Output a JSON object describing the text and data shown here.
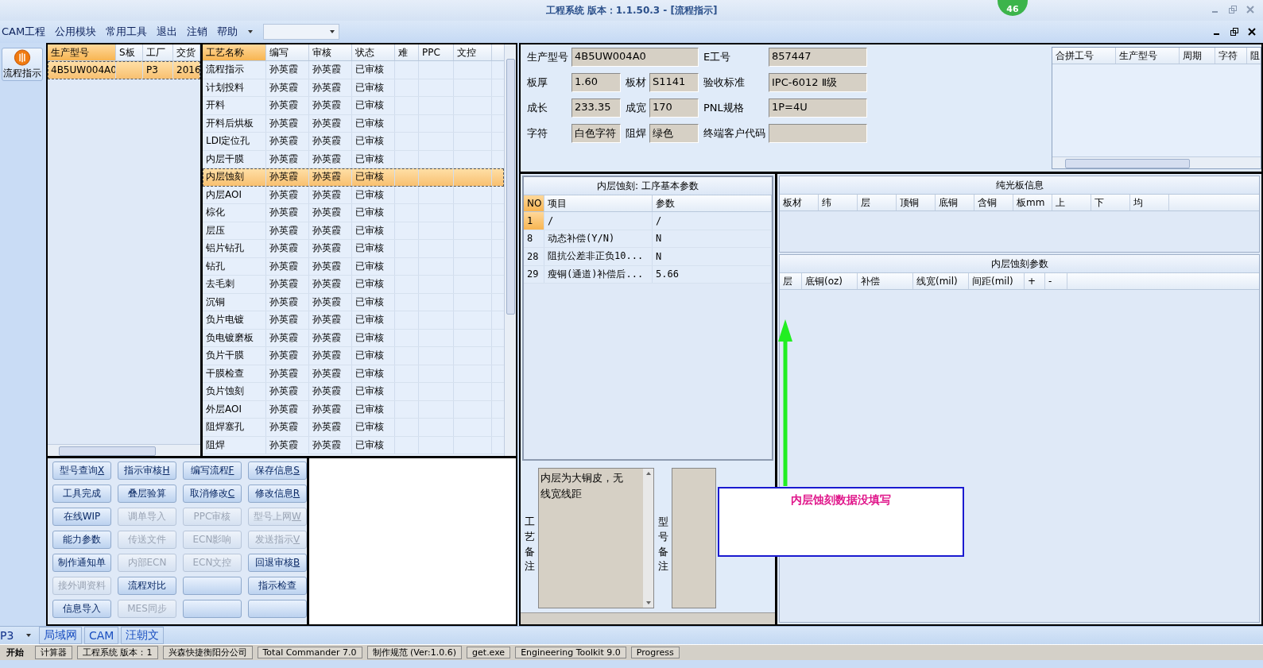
{
  "window": {
    "title": "工程系统  版本：1.1.50.3 - [流程指示]",
    "badge": "46"
  },
  "menu": [
    "CAM工程",
    "公用模块",
    "常用工具",
    "退出",
    "注销",
    "帮助"
  ],
  "sidebar": {
    "label": "流程指示"
  },
  "models": {
    "columns": [
      "生产型号",
      "S板",
      "工厂",
      "交货"
    ],
    "rows": [
      {
        "cells": [
          "4B5UW004A0",
          "",
          "P3",
          "2016"
        ],
        "selected": true
      }
    ]
  },
  "process": {
    "columns": [
      "工艺名称",
      "编写",
      "审核",
      "状态",
      "难",
      "PPC",
      "文控"
    ],
    "rows": [
      {
        "cells": [
          "流程指示",
          "孙英霞",
          "孙英霞",
          "已审核"
        ],
        "selected": false
      },
      {
        "cells": [
          "计划投料",
          "孙英霞",
          "孙英霞",
          "已审核"
        ],
        "selected": false
      },
      {
        "cells": [
          "开料",
          "孙英霞",
          "孙英霞",
          "已审核"
        ],
        "selected": false
      },
      {
        "cells": [
          "开料后烘板",
          "孙英霞",
          "孙英霞",
          "已审核"
        ],
        "selected": false
      },
      {
        "cells": [
          "LDI定位孔",
          "孙英霞",
          "孙英霞",
          "已审核"
        ],
        "selected": false
      },
      {
        "cells": [
          "内层干膜",
          "孙英霞",
          "孙英霞",
          "已审核"
        ],
        "selected": false
      },
      {
        "cells": [
          "内层蚀刻",
          "孙英霞",
          "孙英霞",
          "已审核"
        ],
        "selected": true
      },
      {
        "cells": [
          "内层AOI",
          "孙英霞",
          "孙英霞",
          "已审核"
        ],
        "selected": false
      },
      {
        "cells": [
          "棕化",
          "孙英霞",
          "孙英霞",
          "已审核"
        ],
        "selected": false
      },
      {
        "cells": [
          "层压",
          "孙英霞",
          "孙英霞",
          "已审核"
        ],
        "selected": false
      },
      {
        "cells": [
          "铝片钻孔",
          "孙英霞",
          "孙英霞",
          "已审核"
        ],
        "selected": false
      },
      {
        "cells": [
          "钻孔",
          "孙英霞",
          "孙英霞",
          "已审核"
        ],
        "selected": false
      },
      {
        "cells": [
          "去毛刺",
          "孙英霞",
          "孙英霞",
          "已审核"
        ],
        "selected": false
      },
      {
        "cells": [
          "沉铜",
          "孙英霞",
          "孙英霞",
          "已审核"
        ],
        "selected": false
      },
      {
        "cells": [
          "负片电镀",
          "孙英霞",
          "孙英霞",
          "已审核"
        ],
        "selected": false
      },
      {
        "cells": [
          "负电镀磨板",
          "孙英霞",
          "孙英霞",
          "已审核"
        ],
        "selected": false
      },
      {
        "cells": [
          "负片干膜",
          "孙英霞",
          "孙英霞",
          "已审核"
        ],
        "selected": false
      },
      {
        "cells": [
          "干膜检查",
          "孙英霞",
          "孙英霞",
          "已审核"
        ],
        "selected": false
      },
      {
        "cells": [
          "负片蚀刻",
          "孙英霞",
          "孙英霞",
          "已审核"
        ],
        "selected": false
      },
      {
        "cells": [
          "外层AOI",
          "孙英霞",
          "孙英霞",
          "已审核"
        ],
        "selected": false
      },
      {
        "cells": [
          "阻焊塞孔",
          "孙英霞",
          "孙英霞",
          "已审核"
        ],
        "selected": false
      },
      {
        "cells": [
          "阻焊",
          "孙英霞",
          "孙英霞",
          "已审核"
        ],
        "selected": false
      }
    ]
  },
  "buttons": [
    {
      "kind": "button",
      "label": "型号查询",
      "key": "X",
      "disabled": false
    },
    {
      "kind": "button",
      "label": "指示审核",
      "key": "H",
      "disabled": false
    },
    {
      "kind": "button",
      "label": "编写流程",
      "key": "F",
      "disabled": false
    },
    {
      "kind": "button",
      "label": "保存信息",
      "key": "S",
      "disabled": false
    },
    {
      "kind": "button",
      "label": "工具完成",
      "disabled": false
    },
    {
      "kind": "button",
      "label": "叠层验算",
      "disabled": false
    },
    {
      "kind": "button",
      "label": "取消修改",
      "key": "C",
      "disabled": false
    },
    {
      "kind": "button",
      "label": "修改信息",
      "key": "R",
      "disabled": false
    },
    {
      "kind": "button",
      "label": "在线WIP",
      "disabled": false
    },
    {
      "kind": "button",
      "label": "调单导入",
      "disabled": true
    },
    {
      "kind": "button",
      "label": "PPC审核",
      "disabled": true
    },
    {
      "kind": "button",
      "label": "型号上网",
      "key": "W",
      "disabled": true
    },
    {
      "kind": "button",
      "label": "能力参数",
      "disabled": false
    },
    {
      "kind": "button",
      "label": "传送文件",
      "disabled": true
    },
    {
      "kind": "button",
      "label": "ECN影响",
      "disabled": true
    },
    {
      "kind": "button",
      "label": "发送指示",
      "key": "V",
      "disabled": true
    },
    {
      "kind": "button",
      "label": "制作通知单",
      "disabled": false
    },
    {
      "kind": "button",
      "label": "内部ECN",
      "disabled": true
    },
    {
      "kind": "button",
      "label": "ECN文控",
      "disabled": true
    },
    {
      "kind": "button",
      "label": "回退审核",
      "key": "B",
      "disabled": false
    },
    {
      "kind": "button",
      "label": "接外调资料",
      "disabled": true
    },
    {
      "kind": "button",
      "label": "流程对比",
      "disabled": false
    },
    {
      "kind": "blank",
      "disabled": false
    },
    {
      "kind": "button",
      "label": "指示检查",
      "disabled": false
    },
    {
      "kind": "button",
      "label": "信息导入",
      "disabled": false
    },
    {
      "kind": "button",
      "label": "MES同步",
      "disabled": true
    },
    {
      "kind": "blank",
      "disabled": false
    },
    {
      "kind": "blank",
      "disabled": false
    }
  ],
  "info": {
    "fields": [
      {
        "label": "生产型号",
        "value": "4B5UW004A0"
      },
      {
        "label": "E工号",
        "value": "857447"
      },
      {
        "label": "板厚",
        "value": "1.60"
      },
      {
        "label": "板材",
        "value": "S1141"
      },
      {
        "label": "验收标准",
        "value": "IPC-6012 Ⅱ级"
      },
      {
        "label": "成长",
        "value": "233.35"
      },
      {
        "label": "成宽",
        "value": "170"
      },
      {
        "label": "PNL规格",
        "value": "1P=4U"
      },
      {
        "label": "字符",
        "value": "白色字符"
      },
      {
        "label": "阻焊",
        "value": "绿色"
      },
      {
        "label": "终端客户代码"
      }
    ]
  },
  "merge_table": {
    "columns": [
      "合拼工号",
      "生产型号",
      "周期",
      "字符",
      "阻"
    ]
  },
  "params": {
    "title": "内层蚀刻: 工序基本参数",
    "columns": [
      "NO",
      "项目",
      "参数"
    ],
    "rows": [
      {
        "cells": [
          "1",
          "/",
          "/"
        ],
        "selected": true
      },
      {
        "cells": [
          "8",
          "动态补偿(Y/N)",
          "N"
        ],
        "selected": false
      },
      {
        "cells": [
          "28",
          "阻抗公差非正负10...",
          "N"
        ],
        "selected": false
      },
      {
        "cells": [
          "29",
          "瘦铜(通道)补偿后...",
          "5.66"
        ],
        "selected": false
      }
    ]
  },
  "remarks": [
    {
      "label": "工艺备注",
      "value": "内层为大铜皮，无线宽线距"
    },
    {
      "label": "型号备注"
    }
  ],
  "board_info": {
    "title": "纯光板信息",
    "columns": [
      "板材",
      "纬",
      "层",
      "顶铜",
      "底铜",
      "含铜",
      "板mm",
      "上",
      "下",
      "均"
    ]
  },
  "etch_params": {
    "title": "内层蚀刻参数",
    "columns": [
      "层",
      "底铜(oz)",
      "补偿",
      "线宽(mil)",
      "间距(mil)",
      "+",
      "-"
    ]
  },
  "annotation": {
    "text": "内层蚀刻数据没填写"
  },
  "status_bar": {
    "plant": "P3",
    "tabs": [
      "局域网",
      "CAM",
      "汪朝文"
    ]
  },
  "taskbar": {
    "start": "开始",
    "items": [
      "计算器",
      "工程系统  版本：1",
      "兴森快捷衡阳分公司",
      "Total Commander 7.0",
      "制作规范 (Ver:1.0.6)",
      "get.exe",
      "Engineering Toolkit 9.0",
      "Progress"
    ]
  }
}
